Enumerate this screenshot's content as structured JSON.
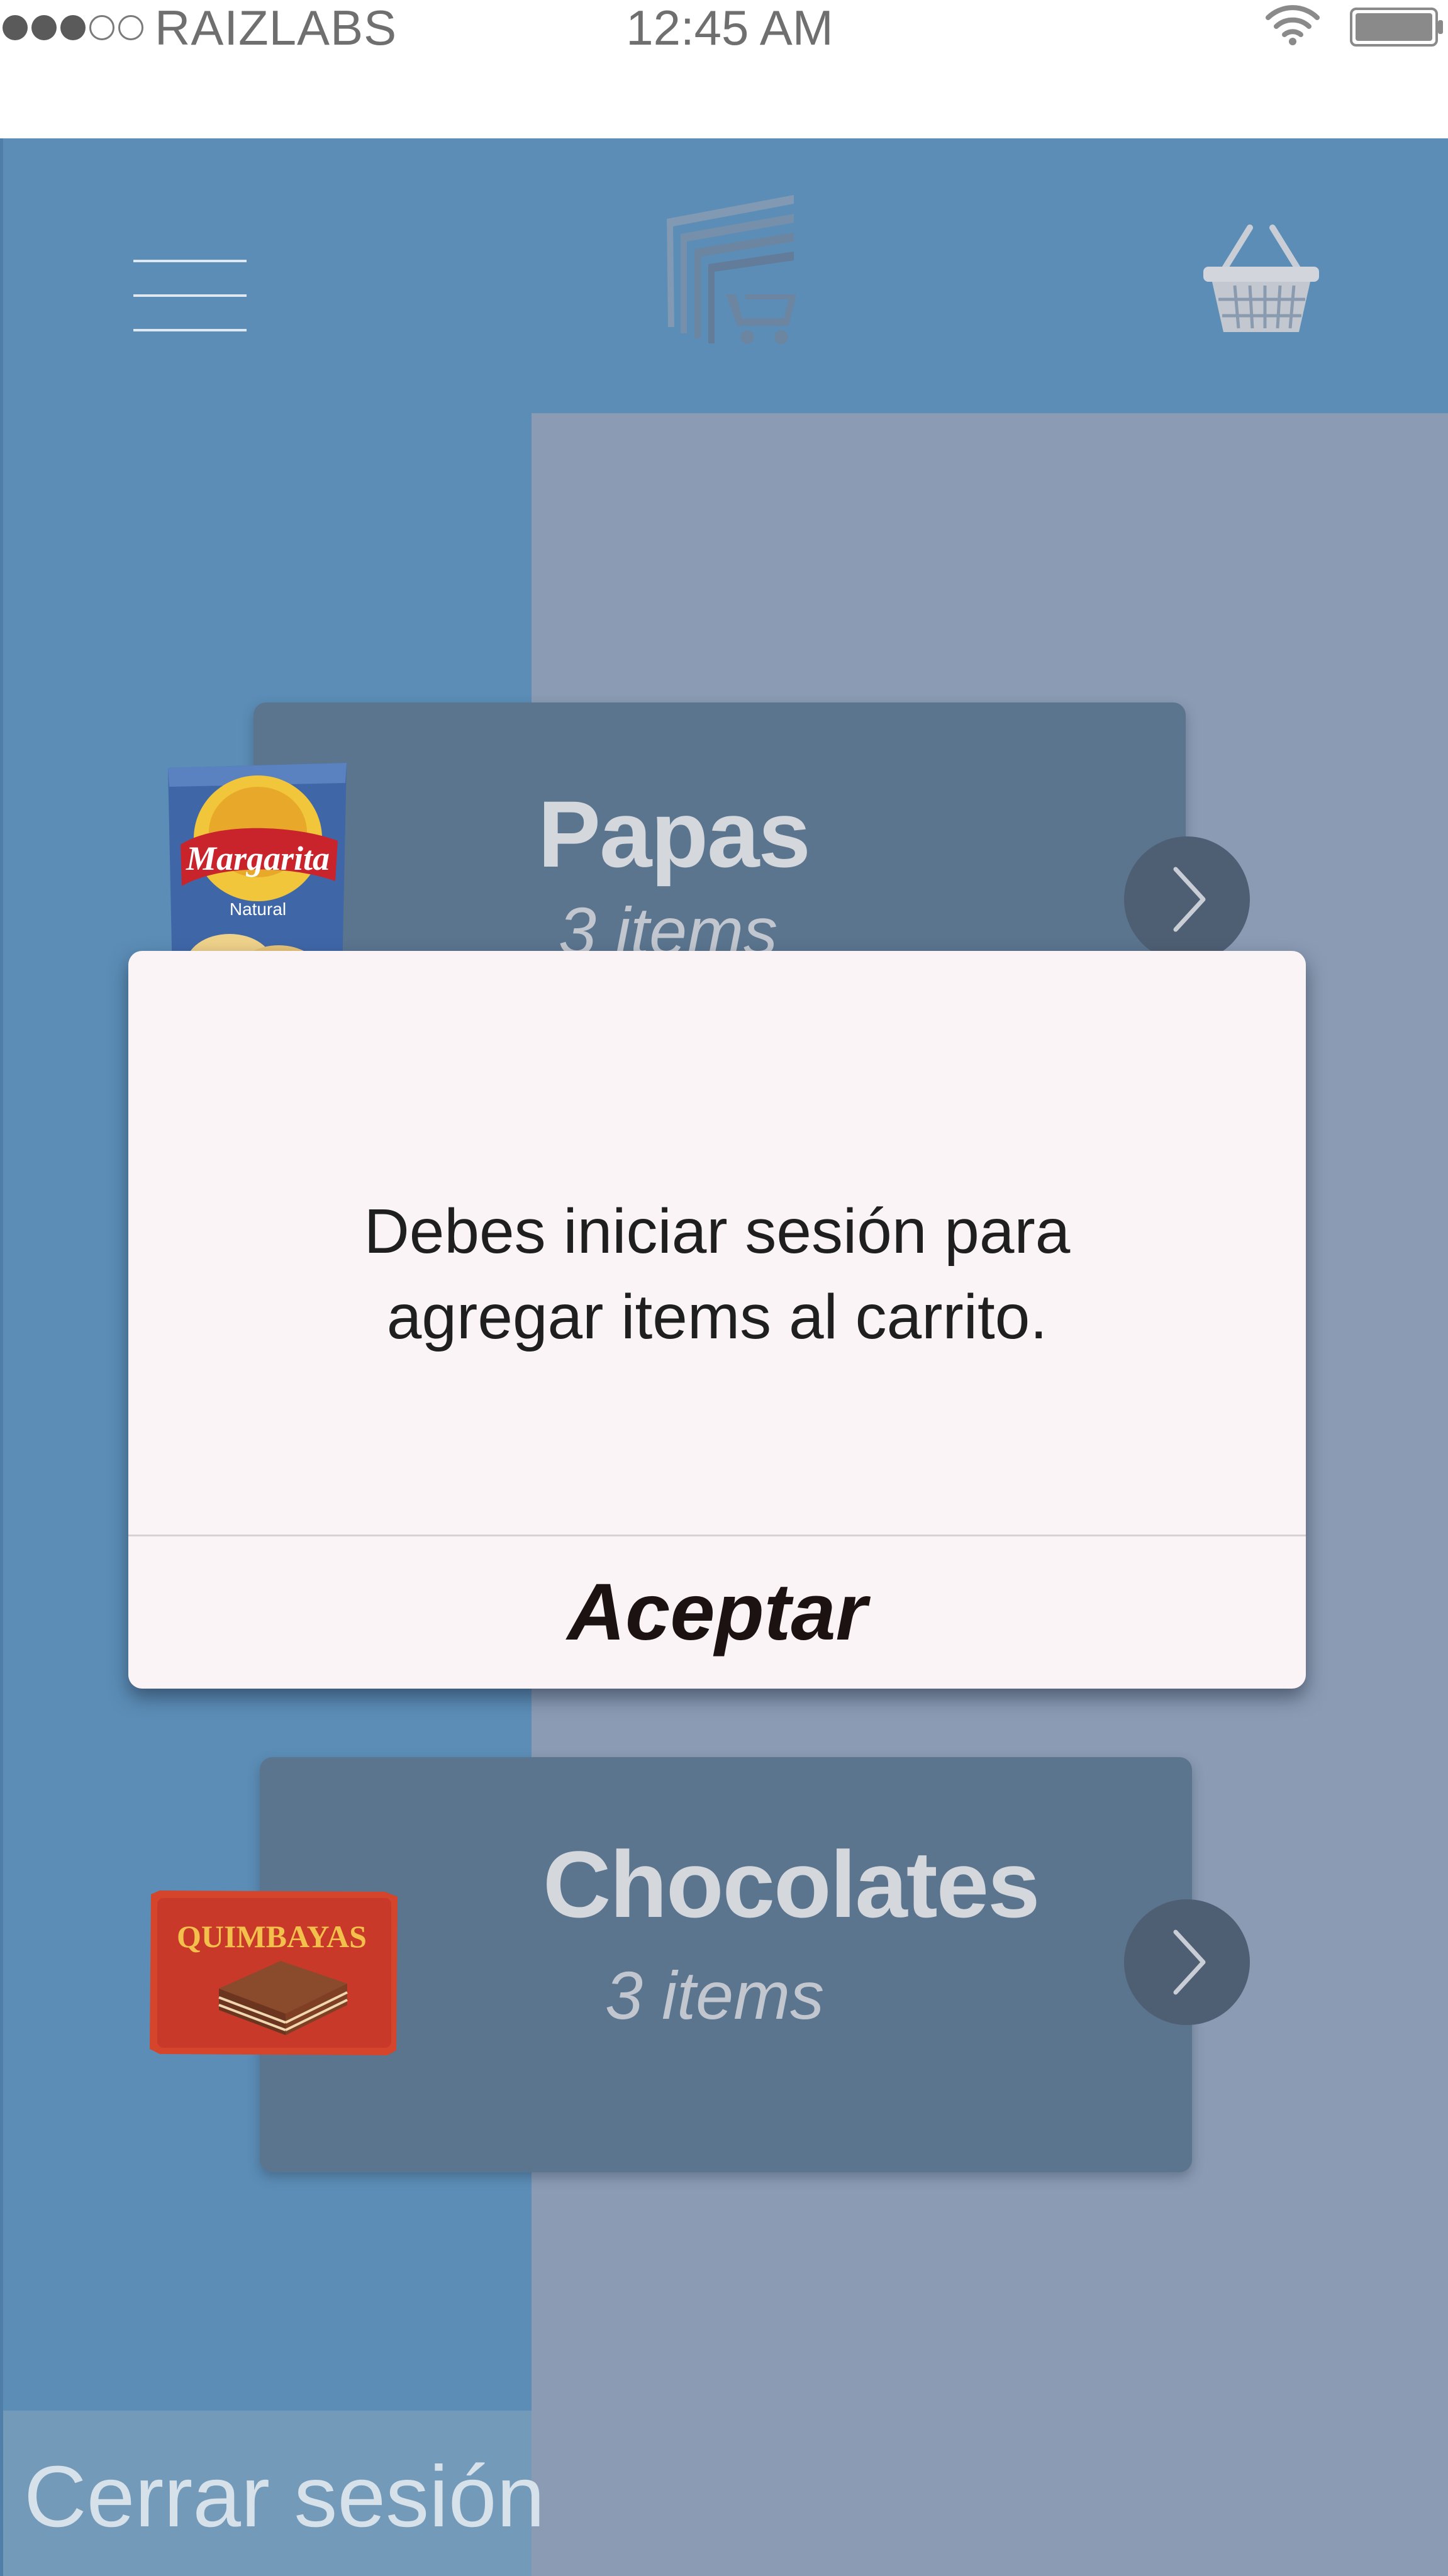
{
  "status_bar": {
    "signal_strength": 3,
    "signal_max": 5,
    "carrier": "RAIZLABS",
    "time": "12:45 AM",
    "wifi_icon": "wifi-icon",
    "battery_icon": "battery-icon"
  },
  "header": {
    "menu_icon": "hamburger-menu-icon",
    "logo_icon": "store-logo-icon",
    "cart_icon": "shopping-basket-icon"
  },
  "categories": [
    {
      "name": "Papas",
      "count": "3 items",
      "image": "margarita-chips-bag"
    },
    {
      "name": "Chocolates",
      "count": "3 items",
      "image": "quimbayas-wafer-pack"
    }
  ],
  "dialog": {
    "message_line1": "Debes iniciar sesión para",
    "message_line2": "agregar items al carrito.",
    "accept_label": "Aceptar"
  },
  "sidebar": {
    "logout_label": "Cerrar sesión"
  },
  "colors": {
    "app_bg": "#5b8db6",
    "panel_bg": "#8a9bb3",
    "card_bg": "#5b758f",
    "dialog_bg": "#fbf4f6"
  }
}
